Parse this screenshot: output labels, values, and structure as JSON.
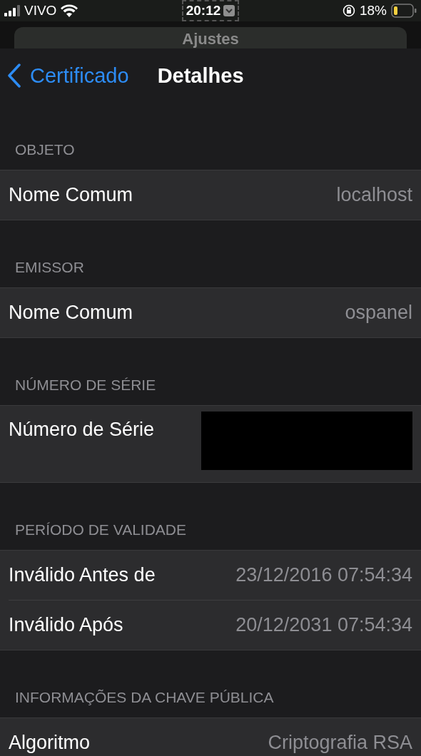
{
  "status_bar": {
    "carrier": "VIVO",
    "time": "20:12",
    "battery": "18%"
  },
  "background_sheet": {
    "title": "Ajustes"
  },
  "nav_bar": {
    "back": "Certificado",
    "title": "Detalhes"
  },
  "sections": [
    {
      "header": "OBJETO",
      "rows": [
        {
          "kind": "text",
          "label": "Nome Comum",
          "value": "localhost"
        }
      ]
    },
    {
      "header": "EMISSOR",
      "rows": [
        {
          "kind": "text",
          "label": "Nome Comum",
          "value": "ospanel"
        }
      ]
    },
    {
      "header": "NÚMERO DE SÉRIE",
      "rows": [
        {
          "kind": "redacted",
          "label": "Número de Série"
        }
      ]
    },
    {
      "header": "PERÍODO DE VALIDADE",
      "rows": [
        {
          "kind": "text",
          "label": "Inválido Antes de",
          "value": "23/12/2016 07:54:34"
        },
        {
          "kind": "text",
          "label": "Inválido Após",
          "value": "20/12/2031 07:54:34"
        }
      ]
    },
    {
      "header": "INFORMAÇÕES DA CHAVE PÚBLICA",
      "rows": [
        {
          "kind": "text",
          "label": "Algoritmo",
          "value": "Criptografia RSA"
        }
      ]
    }
  ]
}
